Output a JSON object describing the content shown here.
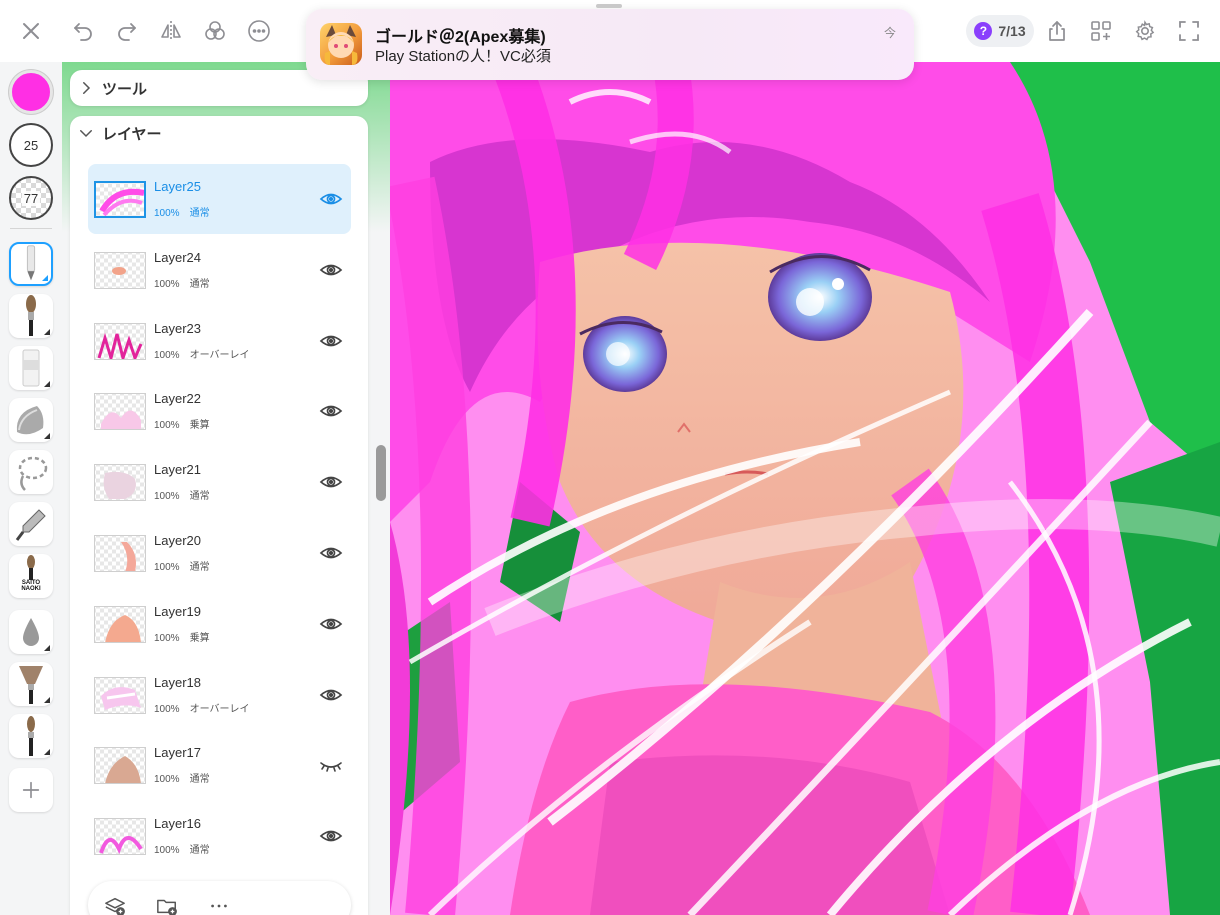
{
  "topbar": {
    "close_icon": "close-icon",
    "undo_icon": "undo-icon",
    "redo_icon": "redo-icon",
    "flip_icon": "flip-icon",
    "materials_icon": "materials-icon",
    "more_icon": "more-icon",
    "page_indicator": "7/13",
    "help_glyph": "?",
    "share_icon": "share-icon",
    "add_grid_icon": "add-grid-icon",
    "settings_icon": "gear-icon",
    "fullscreen_icon": "fullscreen-icon"
  },
  "notification": {
    "title": "ゴールド＠2(Apex募集)",
    "body": "Play Stationの人！VC必須",
    "time": "今"
  },
  "toolstrip": {
    "color_hex": "#ff2fe4",
    "brush_size": "25",
    "brush_opacity": "77",
    "tools": [
      "pen-tool-icon",
      "brush-tool-icon",
      "eraser-tool-icon",
      "smudge-tool-icon",
      "lasso-tool-icon",
      "eyedropper-tool-icon",
      "custom-brush-icon",
      "blur-tool-icon",
      "fan-brush-icon",
      "round-brush-icon",
      "add-tool-icon"
    ],
    "brush_label_lines": [
      "SAITO",
      "NAOKI"
    ]
  },
  "panels": {
    "tools_label": "ツール",
    "layers_label": "レイヤー"
  },
  "layers": [
    {
      "name": "Layer25",
      "opacity": "100%",
      "blend": "通常",
      "visible": true,
      "active": true
    },
    {
      "name": "Layer24",
      "opacity": "100%",
      "blend": "通常",
      "visible": true,
      "active": false
    },
    {
      "name": "Layer23",
      "opacity": "100%",
      "blend": "オーバーレイ",
      "visible": true,
      "active": false
    },
    {
      "name": "Layer22",
      "opacity": "100%",
      "blend": "乗算",
      "visible": true,
      "active": false
    },
    {
      "name": "Layer21",
      "opacity": "100%",
      "blend": "通常",
      "visible": true,
      "active": false
    },
    {
      "name": "Layer20",
      "opacity": "100%",
      "blend": "通常",
      "visible": true,
      "active": false
    },
    {
      "name": "Layer19",
      "opacity": "100%",
      "blend": "乗算",
      "visible": true,
      "active": false
    },
    {
      "name": "Layer18",
      "opacity": "100%",
      "blend": "オーバーレイ",
      "visible": true,
      "active": false
    },
    {
      "name": "Layer17",
      "opacity": "100%",
      "blend": "通常",
      "visible": false,
      "active": false
    },
    {
      "name": "Layer16",
      "opacity": "100%",
      "blend": "通常",
      "visible": true,
      "active": false
    }
  ],
  "layer_toolbar": {
    "add_layer_icon": "add-layer-icon",
    "add_folder_icon": "add-folder-icon",
    "more_icon": "more-icon"
  },
  "colors": {
    "accent": "#1a8ee6",
    "active_row": "#dff0fc",
    "canvas_pink": "#ff2fe4",
    "canvas_green": "#1fbf4a"
  }
}
